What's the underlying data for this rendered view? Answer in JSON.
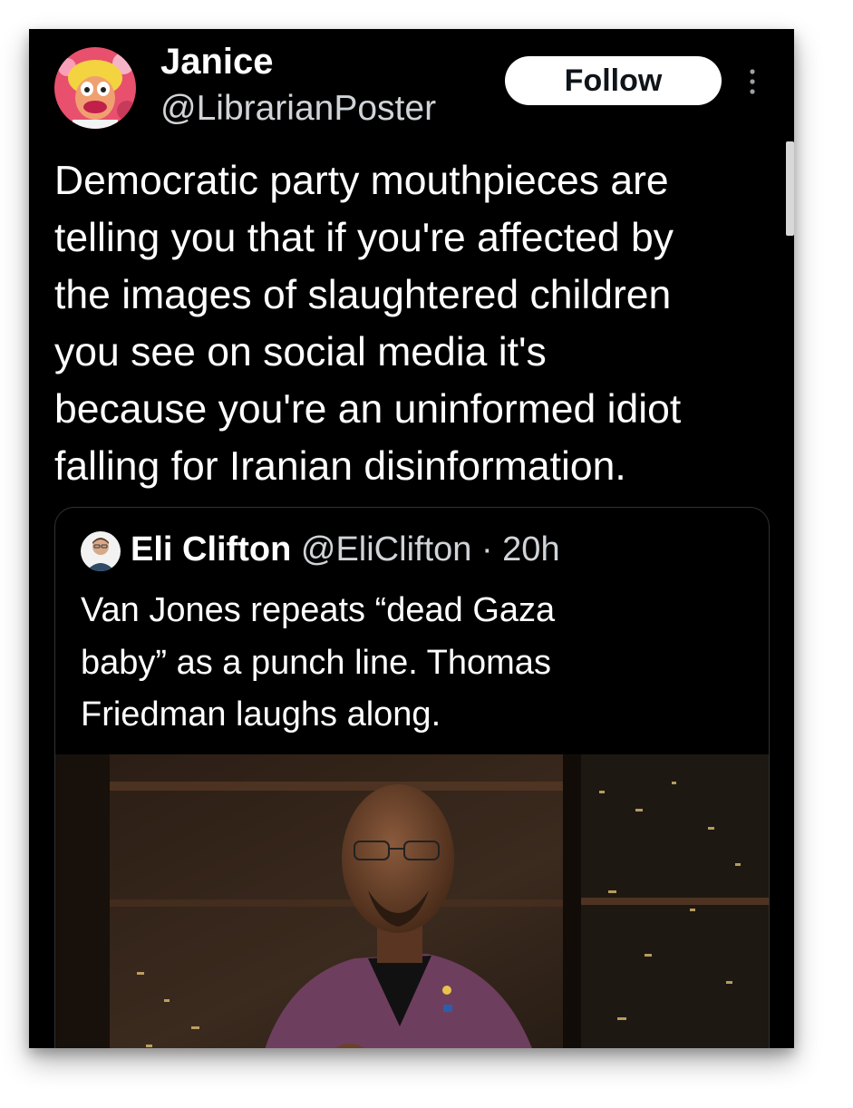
{
  "post": {
    "author": {
      "name": "Janice",
      "handle": "@LibrarianPoster",
      "avatar_icon": "muppet-avatar"
    },
    "follow_label": "Follow",
    "more_icon": "vertical-ellipsis-icon",
    "text_lines": [
      "Democratic party mouthpieces are",
      "telling you that if you're affected by",
      "the images of slaughtered children",
      "you see on social media it's",
      "because you're an uninformed idiot",
      "falling for Iranian disinformation."
    ]
  },
  "quoted_post": {
    "author": {
      "name": "Eli Clifton",
      "handle": "@EliClifton",
      "separator": "·",
      "time": "20h",
      "avatar_icon": "profile-photo-avatar"
    },
    "text_lines": [
      "Van Jones repeats “dead Gaza",
      "baby” as a punch line. Thomas",
      "Friedman laughs along."
    ],
    "media": {
      "type": "video-thumbnail",
      "description_icon": "video-frame-man-in-purple-jacket"
    }
  },
  "colors": {
    "background": "#000000",
    "text_primary": "#ffffff",
    "text_secondary": "#d0d4d8",
    "follow_button_bg": "#ffffff",
    "follow_button_text": "#0f1419",
    "border": "#2f3336"
  }
}
